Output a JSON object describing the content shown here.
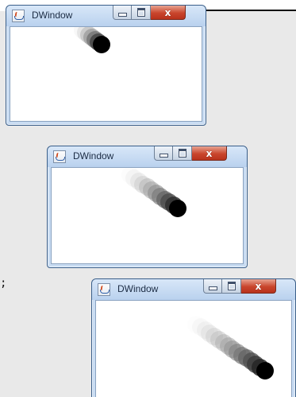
{
  "windows": [
    {
      "title": "DWindow",
      "close_glyph": "x"
    },
    {
      "title": "DWindow",
      "close_glyph": "x"
    },
    {
      "title": "DWindow",
      "close_glyph": "x"
    }
  ],
  "code_fragment": ";",
  "icons": {
    "app": "java-app-icon",
    "minimize": "minimize-icon",
    "maximize": "maximize-icon",
    "close": "close-icon"
  },
  "colors": {
    "titlebar": "#c9dcf2",
    "close_button": "#c9452c",
    "ball": "#000000",
    "background_panel": "#e9e9e9"
  }
}
